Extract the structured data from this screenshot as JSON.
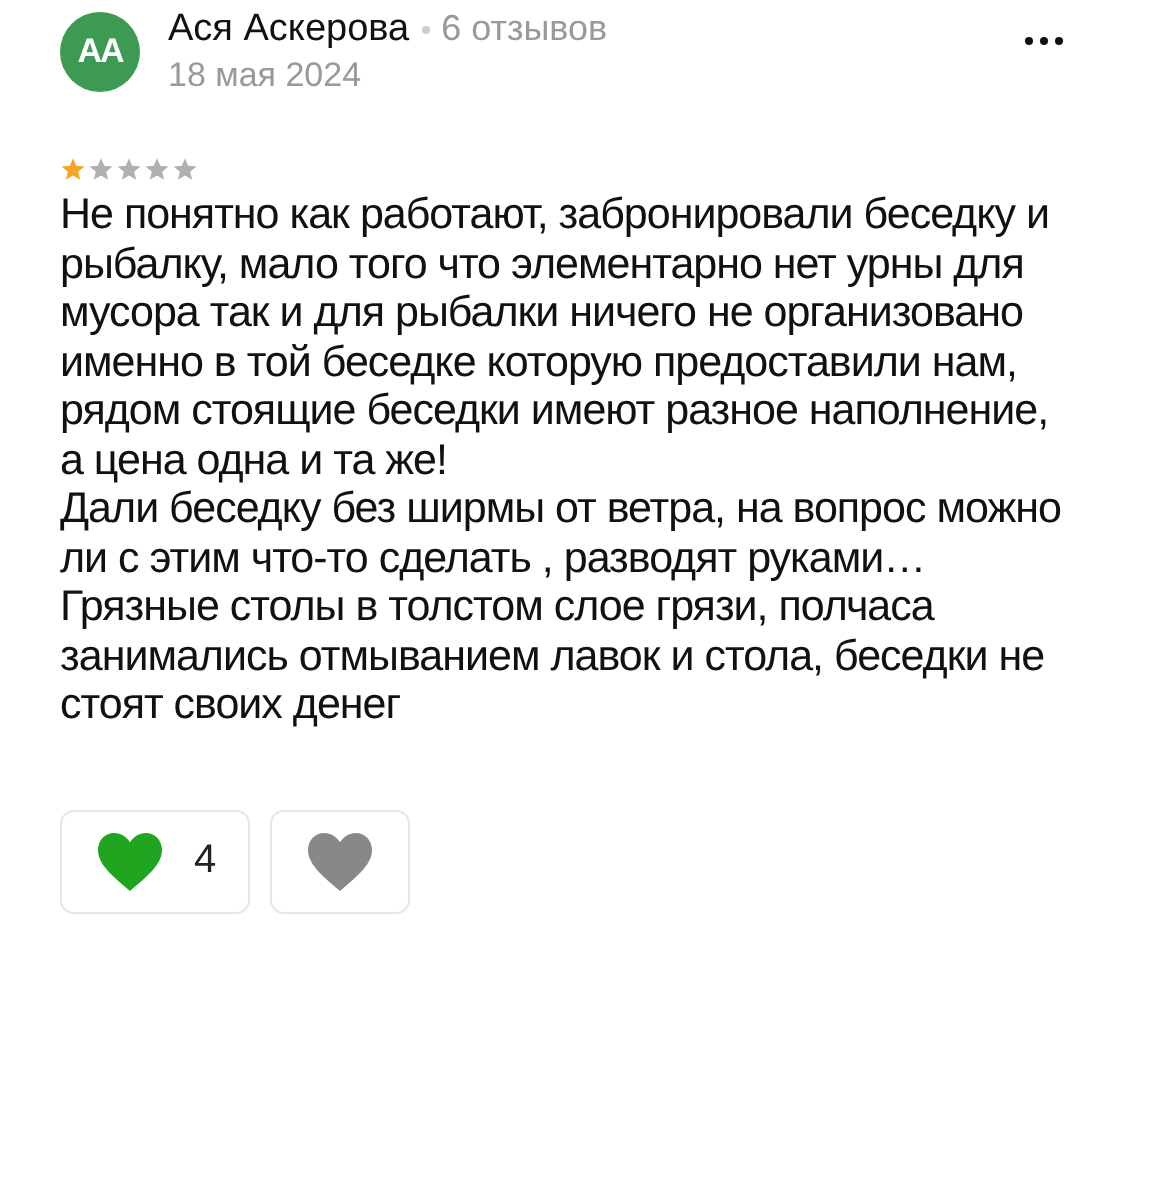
{
  "review": {
    "author": {
      "initials": "AA",
      "name": "Ася Аскерова",
      "reviews_count": "6 отзывов"
    },
    "date": "18 мая 2024",
    "stars": 1,
    "paragraphs": [
      "Не понятно как работают, забронировали беседку и рыбалку, мало того что элементарно нет урны для мусора так и для рыбалки ничего не организовано именно в той беседке которую предоставили нам, рядом стоящие беседки имеют разное наполнение, а цена одна и та же!",
      "Дали беседку без ширмы от ветра, на вопрос можно ли с этим что-то сделать , разводят руками…",
      "Грязные столы в толстом слое грязи, полчаса занимались отмыванием лавок и стола, беседки не стоят своих денег"
    ],
    "reactions": [
      {
        "kind": "like",
        "count": "4",
        "selected": true
      },
      {
        "kind": "dislike",
        "selected": false
      }
    ]
  }
}
